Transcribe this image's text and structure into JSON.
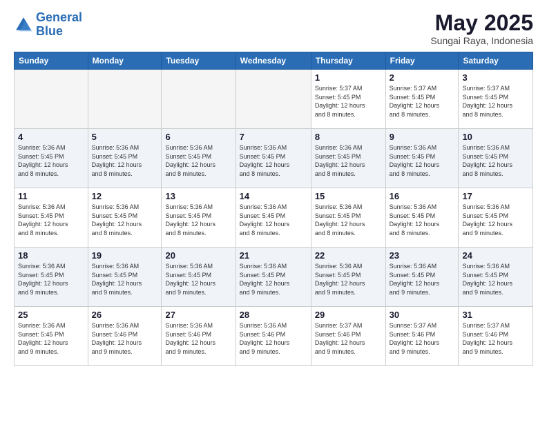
{
  "logo": {
    "line1": "General",
    "line2": "Blue"
  },
  "title": "May 2025",
  "subtitle": "Sungai Raya, Indonesia",
  "weekdays": [
    "Sunday",
    "Monday",
    "Tuesday",
    "Wednesday",
    "Thursday",
    "Friday",
    "Saturday"
  ],
  "weeks": [
    [
      {
        "day": "",
        "empty": true
      },
      {
        "day": "",
        "empty": true
      },
      {
        "day": "",
        "empty": true
      },
      {
        "day": "",
        "empty": true
      },
      {
        "day": "1",
        "info": "Sunrise: 5:37 AM\nSunset: 5:45 PM\nDaylight: 12 hours\nand 8 minutes."
      },
      {
        "day": "2",
        "info": "Sunrise: 5:37 AM\nSunset: 5:45 PM\nDaylight: 12 hours\nand 8 minutes."
      },
      {
        "day": "3",
        "info": "Sunrise: 5:37 AM\nSunset: 5:45 PM\nDaylight: 12 hours\nand 8 minutes."
      }
    ],
    [
      {
        "day": "4",
        "info": "Sunrise: 5:36 AM\nSunset: 5:45 PM\nDaylight: 12 hours\nand 8 minutes."
      },
      {
        "day": "5",
        "info": "Sunrise: 5:36 AM\nSunset: 5:45 PM\nDaylight: 12 hours\nand 8 minutes."
      },
      {
        "day": "6",
        "info": "Sunrise: 5:36 AM\nSunset: 5:45 PM\nDaylight: 12 hours\nand 8 minutes."
      },
      {
        "day": "7",
        "info": "Sunrise: 5:36 AM\nSunset: 5:45 PM\nDaylight: 12 hours\nand 8 minutes."
      },
      {
        "day": "8",
        "info": "Sunrise: 5:36 AM\nSunset: 5:45 PM\nDaylight: 12 hours\nand 8 minutes."
      },
      {
        "day": "9",
        "info": "Sunrise: 5:36 AM\nSunset: 5:45 PM\nDaylight: 12 hours\nand 8 minutes."
      },
      {
        "day": "10",
        "info": "Sunrise: 5:36 AM\nSunset: 5:45 PM\nDaylight: 12 hours\nand 8 minutes."
      }
    ],
    [
      {
        "day": "11",
        "info": "Sunrise: 5:36 AM\nSunset: 5:45 PM\nDaylight: 12 hours\nand 8 minutes."
      },
      {
        "day": "12",
        "info": "Sunrise: 5:36 AM\nSunset: 5:45 PM\nDaylight: 12 hours\nand 8 minutes."
      },
      {
        "day": "13",
        "info": "Sunrise: 5:36 AM\nSunset: 5:45 PM\nDaylight: 12 hours\nand 8 minutes."
      },
      {
        "day": "14",
        "info": "Sunrise: 5:36 AM\nSunset: 5:45 PM\nDaylight: 12 hours\nand 8 minutes."
      },
      {
        "day": "15",
        "info": "Sunrise: 5:36 AM\nSunset: 5:45 PM\nDaylight: 12 hours\nand 8 minutes."
      },
      {
        "day": "16",
        "info": "Sunrise: 5:36 AM\nSunset: 5:45 PM\nDaylight: 12 hours\nand 8 minutes."
      },
      {
        "day": "17",
        "info": "Sunrise: 5:36 AM\nSunset: 5:45 PM\nDaylight: 12 hours\nand 9 minutes."
      }
    ],
    [
      {
        "day": "18",
        "info": "Sunrise: 5:36 AM\nSunset: 5:45 PM\nDaylight: 12 hours\nand 9 minutes."
      },
      {
        "day": "19",
        "info": "Sunrise: 5:36 AM\nSunset: 5:45 PM\nDaylight: 12 hours\nand 9 minutes."
      },
      {
        "day": "20",
        "info": "Sunrise: 5:36 AM\nSunset: 5:45 PM\nDaylight: 12 hours\nand 9 minutes."
      },
      {
        "day": "21",
        "info": "Sunrise: 5:36 AM\nSunset: 5:45 PM\nDaylight: 12 hours\nand 9 minutes."
      },
      {
        "day": "22",
        "info": "Sunrise: 5:36 AM\nSunset: 5:45 PM\nDaylight: 12 hours\nand 9 minutes."
      },
      {
        "day": "23",
        "info": "Sunrise: 5:36 AM\nSunset: 5:45 PM\nDaylight: 12 hours\nand 9 minutes."
      },
      {
        "day": "24",
        "info": "Sunrise: 5:36 AM\nSunset: 5:45 PM\nDaylight: 12 hours\nand 9 minutes."
      }
    ],
    [
      {
        "day": "25",
        "info": "Sunrise: 5:36 AM\nSunset: 5:45 PM\nDaylight: 12 hours\nand 9 minutes."
      },
      {
        "day": "26",
        "info": "Sunrise: 5:36 AM\nSunset: 5:46 PM\nDaylight: 12 hours\nand 9 minutes."
      },
      {
        "day": "27",
        "info": "Sunrise: 5:36 AM\nSunset: 5:46 PM\nDaylight: 12 hours\nand 9 minutes."
      },
      {
        "day": "28",
        "info": "Sunrise: 5:36 AM\nSunset: 5:46 PM\nDaylight: 12 hours\nand 9 minutes."
      },
      {
        "day": "29",
        "info": "Sunrise: 5:37 AM\nSunset: 5:46 PM\nDaylight: 12 hours\nand 9 minutes."
      },
      {
        "day": "30",
        "info": "Sunrise: 5:37 AM\nSunset: 5:46 PM\nDaylight: 12 hours\nand 9 minutes."
      },
      {
        "day": "31",
        "info": "Sunrise: 5:37 AM\nSunset: 5:46 PM\nDaylight: 12 hours\nand 9 minutes."
      }
    ]
  ]
}
